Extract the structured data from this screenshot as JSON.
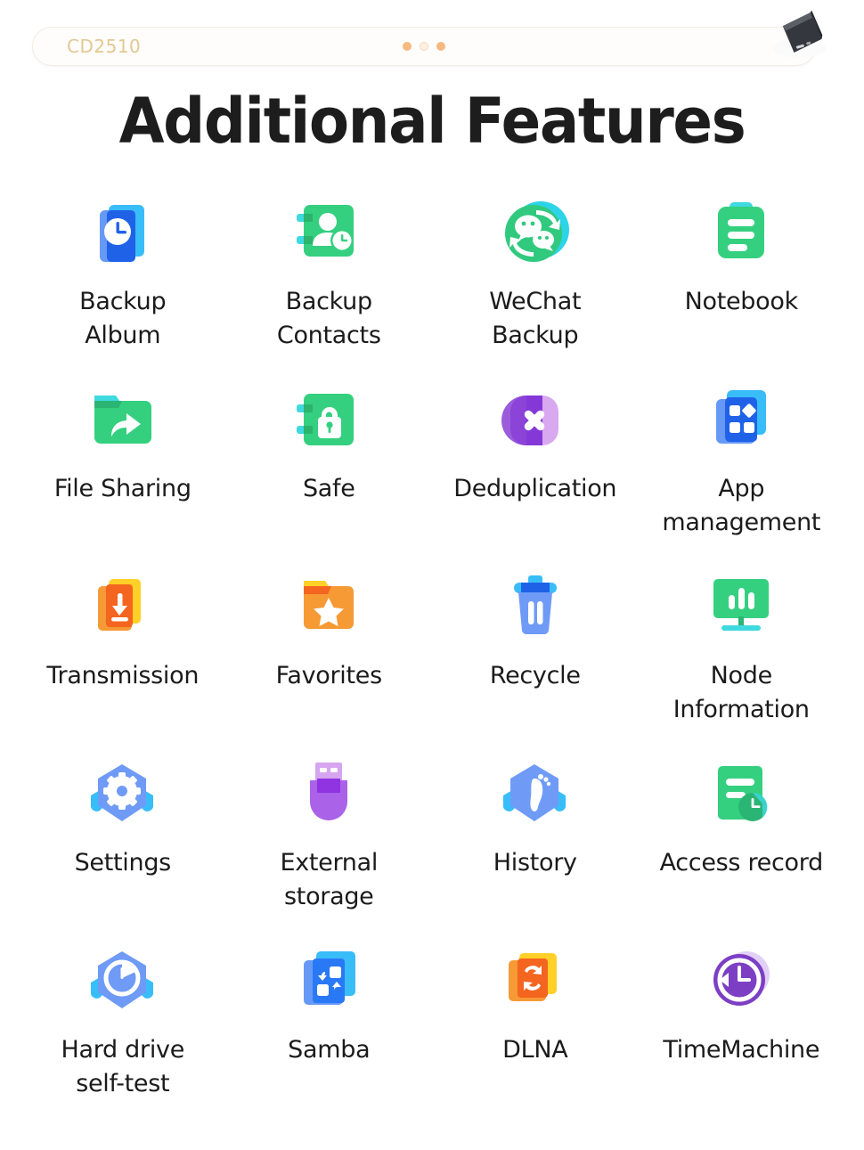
{
  "topbar": {
    "device_model": "CD2510",
    "dots": [
      "filled",
      "hollow",
      "filled"
    ],
    "device_icon": "portable-ssd-icon"
  },
  "header": {
    "title": "Additional Features"
  },
  "colors": {
    "accent_gold": "#e3c893",
    "dot_orange": "#f6b980",
    "green": "#34d07f",
    "cyan": "#3fd9e0",
    "blue": "#2979f6",
    "light_blue": "#6699f5",
    "sky": "#39bdf8",
    "purple": "#9d5ae0",
    "light_purple": "#cfa3ee",
    "orange": "#f59a35",
    "deep_orange": "#f4651f",
    "yellow": "#ffd028",
    "title_text": "#1d1d1d",
    "label_text": "#1b1b1b"
  },
  "grid": {
    "columns": 4,
    "items": [
      {
        "id": "backup-album",
        "label": "Backup\nAlbum",
        "icon": "backup-album-icon"
      },
      {
        "id": "backup-contacts",
        "label": "Backup\nContacts",
        "icon": "backup-contacts-icon"
      },
      {
        "id": "wechat-backup",
        "label": "WeChat\nBackup",
        "icon": "wechat-backup-icon"
      },
      {
        "id": "notebook",
        "label": "Notebook",
        "icon": "notebook-icon"
      },
      {
        "id": "file-sharing",
        "label": "File Sharing",
        "icon": "file-sharing-icon"
      },
      {
        "id": "safe",
        "label": "Safe",
        "icon": "safe-lock-icon"
      },
      {
        "id": "deduplication",
        "label": "Deduplication",
        "icon": "deduplication-icon"
      },
      {
        "id": "app-management",
        "label": "App\nmanagement",
        "icon": "app-management-icon"
      },
      {
        "id": "transmission",
        "label": "Transmission",
        "icon": "transmission-icon"
      },
      {
        "id": "favorites",
        "label": "Favorites",
        "icon": "favorites-star-icon"
      },
      {
        "id": "recycle",
        "label": "Recycle",
        "icon": "recycle-bin-icon"
      },
      {
        "id": "node-information",
        "label": "Node\nInformation",
        "icon": "node-information-icon"
      },
      {
        "id": "settings",
        "label": "Settings",
        "icon": "settings-gear-icon"
      },
      {
        "id": "external-storage",
        "label": "External\nstorage",
        "icon": "usb-drive-icon"
      },
      {
        "id": "history",
        "label": "History",
        "icon": "history-footprint-icon"
      },
      {
        "id": "access-record",
        "label": "Access record",
        "icon": "access-record-icon"
      },
      {
        "id": "hard-drive-selftest",
        "label": "Hard drive\nself-test",
        "icon": "hard-drive-selftest-icon"
      },
      {
        "id": "samba",
        "label": "Samba",
        "icon": "samba-icon"
      },
      {
        "id": "dlna",
        "label": "DLNA",
        "icon": "dlna-icon"
      },
      {
        "id": "timemachine",
        "label": "TimeMachine",
        "icon": "timemachine-icon"
      }
    ]
  }
}
